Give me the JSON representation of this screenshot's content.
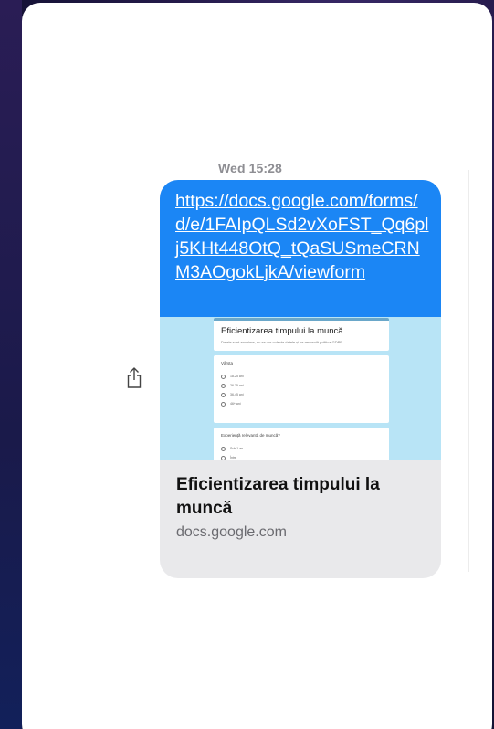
{
  "message": {
    "timestamp": "Wed 15:28",
    "link_text": "https://docs.google.com/forms/d/e/1FAIpQLSd2vXoFST_Qq6plj5KHt448OtQ_tQaSUSmeCRNM3AOgokLjkA/viewform",
    "preview": {
      "form_title": "Eficientizarea timpului la muncă",
      "form_description": "Datele sunt anonime, nu se vor colecta datele și se respectă politica GDPR.",
      "q1_label": "Vârsta",
      "q1_options": [
        "18-25 ani",
        "26-35 ani",
        "36-45 ani",
        "46+ ani"
      ],
      "q2_label": "Experiență relevantă de muncă?",
      "q2_options": [
        "Sub 1 an",
        "Între"
      ]
    },
    "title": "Eficientizarea timpului la muncă",
    "domain": "docs.google.com"
  },
  "icons": {
    "share": "share-icon"
  },
  "colors": {
    "bubble_blue": "#1b86f5",
    "preview_bg": "#b8e4f6",
    "meta_bg": "#e9e9eb"
  }
}
